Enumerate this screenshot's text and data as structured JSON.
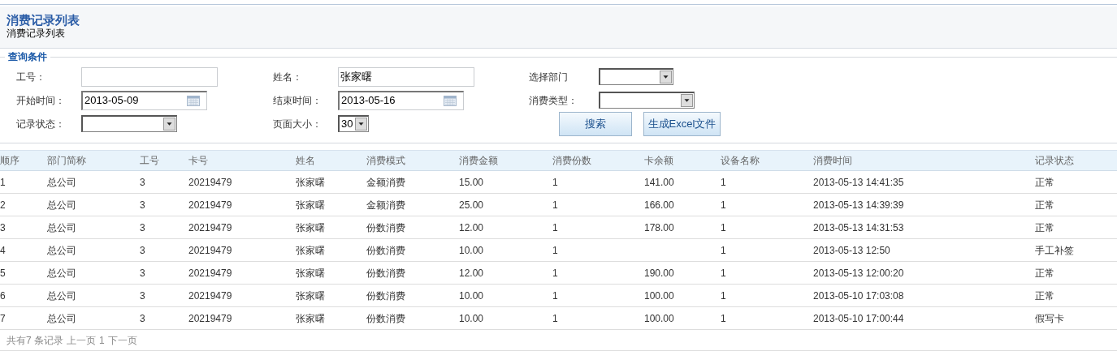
{
  "header": {
    "title": "消费记录列表",
    "subtitle": "消费记录列表"
  },
  "filters": {
    "legend": "查询条件",
    "fields": [
      {
        "label": "工号：",
        "kind": "text"
      },
      {
        "label": "姓名：",
        "kind": "text",
        "value": "张家曙"
      },
      {
        "label": "选择部门",
        "kind": "select"
      },
      {
        "label": "开始时间：",
        "kind": "date",
        "value": "2013-05-09"
      },
      {
        "label": "结束时间：",
        "kind": "date",
        "value": "2013-05-16"
      },
      {
        "label": "消费类型：",
        "kind": "select"
      },
      {
        "label": "记录状态：",
        "kind": "select"
      },
      {
        "label": "页面大小：",
        "kind": "select",
        "value": "30"
      }
    ],
    "buttons": [
      "搜索",
      "生成Excel文件"
    ]
  },
  "table": {
    "columns": [
      "顺序",
      "部门简称",
      "工号",
      "卡号",
      "姓名",
      "消费模式",
      "消费金额",
      "消费份数",
      "卡余额",
      "设备名称",
      "消费时间",
      "记录状态"
    ],
    "rows": [
      [
        "1",
        "总公司",
        "3",
        "20219479",
        "张家曙",
        "金额消费",
        "15.00",
        "1",
        "141.00",
        "1",
        "2013-05-13 14:41:35",
        "正常"
      ],
      [
        "2",
        "总公司",
        "3",
        "20219479",
        "张家曙",
        "金额消费",
        "25.00",
        "1",
        "166.00",
        "1",
        "2013-05-13 14:39:39",
        "正常"
      ],
      [
        "3",
        "总公司",
        "3",
        "20219479",
        "张家曙",
        "份数消费",
        "12.00",
        "1",
        "178.00",
        "1",
        "2013-05-13 14:31:53",
        "正常"
      ],
      [
        "4",
        "总公司",
        "3",
        "20219479",
        "张家曙",
        "份数消费",
        "10.00",
        "1",
        null,
        "1",
        "2013-05-13 12:50",
        "手工补签"
      ],
      [
        "5",
        "总公司",
        "3",
        "20219479",
        "张家曙",
        "份数消费",
        "12.00",
        "1",
        "190.00",
        "1",
        "2013-05-13 12:00:20",
        "正常"
      ],
      [
        "6",
        "总公司",
        "3",
        "20219479",
        "张家曙",
        "份数消费",
        "10.00",
        "1",
        "100.00",
        "1",
        "2013-05-10 17:03:08",
        "正常"
      ],
      [
        "7",
        "总公司",
        "3",
        "20219479",
        "张家曙",
        "份数消费",
        "10.00",
        "1",
        "100.00",
        "1",
        "2013-05-10 17:00:44",
        "假写卡"
      ]
    ]
  },
  "pager": {
    "total": "共有7 条记录",
    "prev": "上一页",
    "page": "1",
    "next": "下一页"
  }
}
